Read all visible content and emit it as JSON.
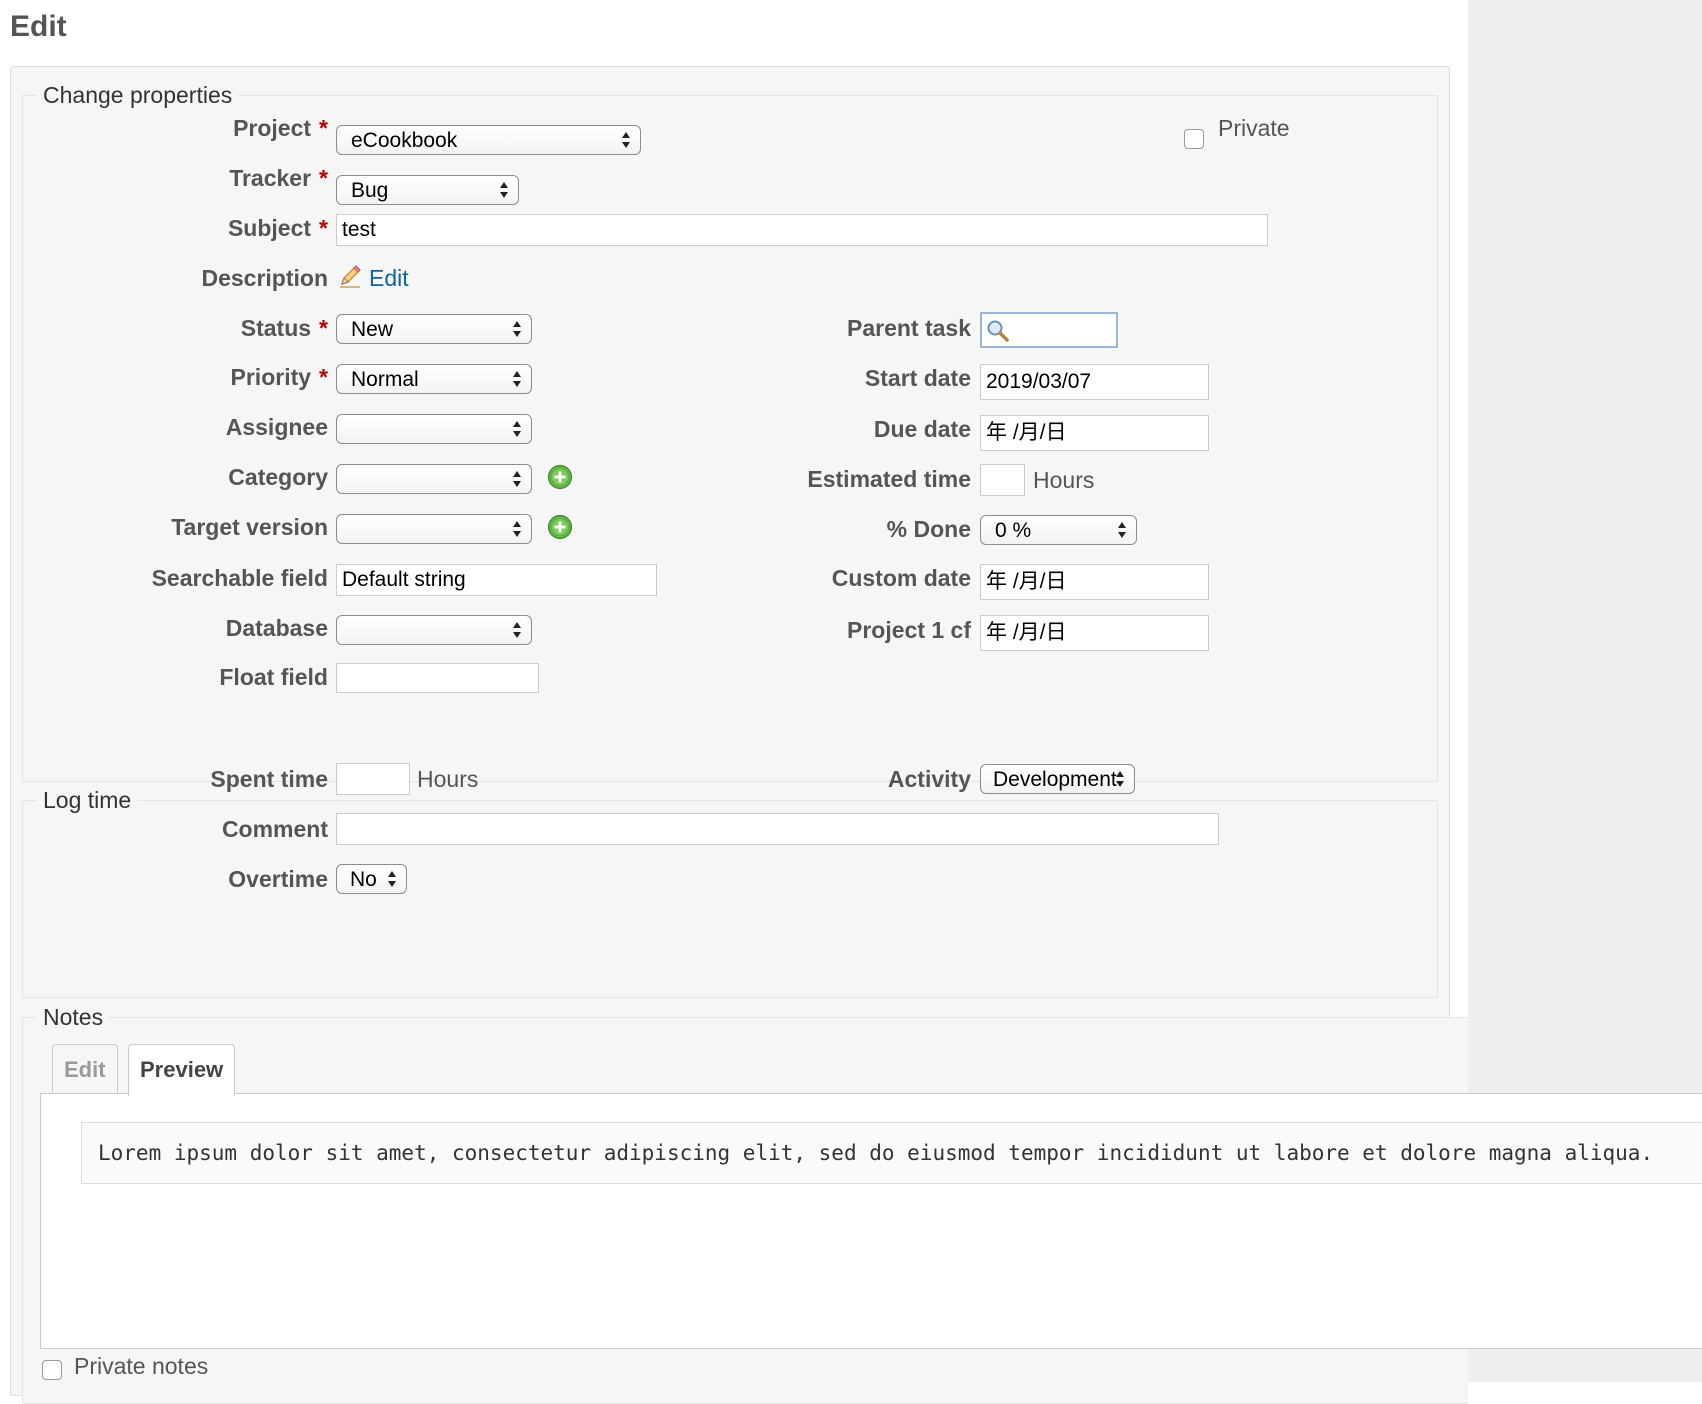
{
  "page": {
    "title": "Edit"
  },
  "properties": {
    "legend": "Change properties",
    "private_label": "Private",
    "project": {
      "label": "Project",
      "required": "*",
      "value": "eCookbook"
    },
    "tracker": {
      "label": "Tracker",
      "required": "*",
      "value": "Bug"
    },
    "subject": {
      "label": "Subject",
      "required": "*",
      "value": "test"
    },
    "description": {
      "label": "Description",
      "edit_link": "Edit"
    },
    "status": {
      "label": "Status",
      "required": "*",
      "value": "New"
    },
    "priority": {
      "label": "Priority",
      "required": "*",
      "value": "Normal"
    },
    "assignee": {
      "label": "Assignee",
      "value": ""
    },
    "category": {
      "label": "Category",
      "value": ""
    },
    "target_version": {
      "label": "Target version",
      "value": ""
    },
    "searchable_field": {
      "label": "Searchable field",
      "value": "Default string"
    },
    "database": {
      "label": "Database",
      "value": ""
    },
    "float_field": {
      "label": "Float field",
      "value": ""
    },
    "parent_task": {
      "label": "Parent task",
      "value": ""
    },
    "start_date": {
      "label": "Start date",
      "value": "2019/03/07"
    },
    "due_date": {
      "label": "Due date",
      "value": "年 /月/日"
    },
    "estimated_time": {
      "label": "Estimated time",
      "unit": "Hours",
      "value": ""
    },
    "done_ratio": {
      "label": "% Done",
      "value": "0 %"
    },
    "custom_date": {
      "label": "Custom date",
      "value": "年 /月/日"
    },
    "project_1_cf": {
      "label": "Project 1 cf",
      "value": "年 /月/日"
    }
  },
  "log_time": {
    "legend": "Log time",
    "spent_time": {
      "label": "Spent time",
      "unit": "Hours",
      "value": ""
    },
    "activity": {
      "label": "Activity",
      "value": "Development"
    },
    "comment": {
      "label": "Comment",
      "value": ""
    },
    "overtime": {
      "label": "Overtime",
      "value": "No"
    }
  },
  "notes": {
    "legend": "Notes",
    "tabs": [
      {
        "label": "Edit"
      },
      {
        "label": "Preview"
      }
    ],
    "preview_text": "Lorem ipsum dolor sit amet, consectetur adipiscing elit, sed do eiusmod tempor incididunt ut labore et dolore magna aliqua.",
    "private_notes_label": "Private notes"
  },
  "icons": {
    "arrows": "select-arrows-icon",
    "plus": "add-plus-icon",
    "pencil": "pencil-icon",
    "search": "magnifier-icon"
  },
  "colors": {
    "required": "#bb0000",
    "link": "#116699",
    "plus": "#62b444"
  }
}
